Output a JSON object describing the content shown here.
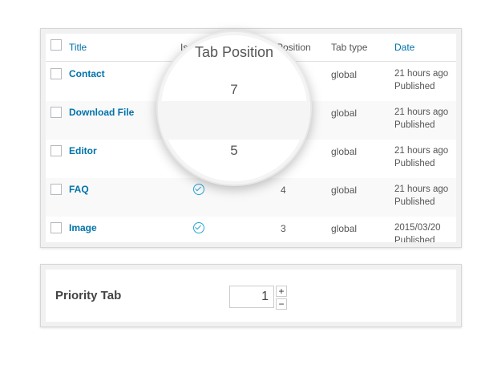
{
  "table": {
    "headers": {
      "title": "Title",
      "is_tab": "Is",
      "position": "Position",
      "tab_type": "Tab type",
      "date": "Date"
    },
    "rows": [
      {
        "title": "Contact",
        "checked": false,
        "position": "",
        "tab_type": "global",
        "date_line1": "21 hours ago",
        "date_line2": "Published"
      },
      {
        "title": "Download File",
        "checked": false,
        "position": "",
        "tab_type": "global",
        "date_line1": "21 hours ago",
        "date_line2": "Published"
      },
      {
        "title": "Editor",
        "checked": false,
        "position": "",
        "tab_type": "global",
        "date_line1": "21 hours ago",
        "date_line2": "Published"
      },
      {
        "title": "FAQ",
        "checked": true,
        "position": "4",
        "tab_type": "global",
        "date_line1": "21 hours ago",
        "date_line2": "Published"
      },
      {
        "title": "Image",
        "checked": true,
        "position": "3",
        "tab_type": "global",
        "date_line1": "2015/03/20",
        "date_line2": "Published"
      }
    ]
  },
  "magnifier": {
    "heading": "Tab Position",
    "value1": "7",
    "value2": "5"
  },
  "priority": {
    "label": "Priority Tab",
    "value": "1",
    "plus": "+",
    "minus": "−"
  },
  "colors": {
    "link": "#0073aa",
    "check": "#27a3d6"
  },
  "icons": {
    "check": "check-circle-icon",
    "plus": "plus-icon",
    "minus": "minus-icon"
  }
}
